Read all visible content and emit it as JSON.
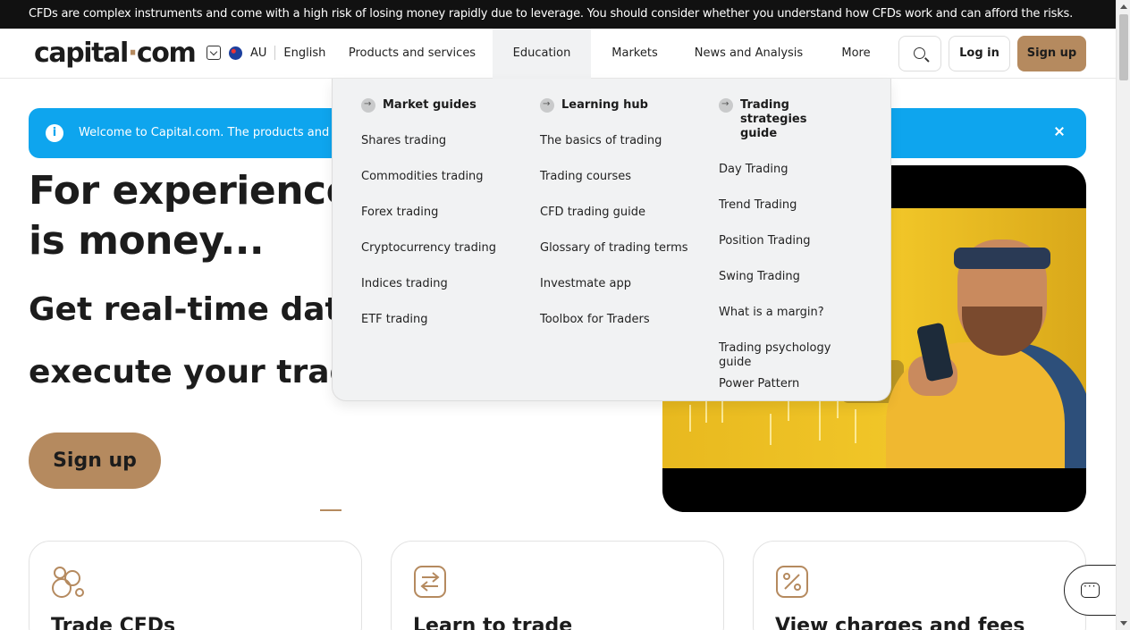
{
  "risk_warning": "CFDs are complex instruments and come with a high risk of losing money rapidly due to leverage. You should consider whether you understand how CFDs work and can afford the risks.",
  "header": {
    "logo_text_1": "capital",
    "logo_dot": "·",
    "logo_text_2": "com",
    "region_code": "AU",
    "language": "English",
    "nav": [
      "Products and services",
      "Education",
      "Markets",
      "News and Analysis",
      "More"
    ],
    "active_nav": "Education",
    "login_label": "Log in",
    "signup_label": "Sign up"
  },
  "banner": {
    "info_glyph": "i",
    "text": "Welcome to Capital.com. The products and serv"
  },
  "education_menu": {
    "columns": [
      {
        "title": "Market guides",
        "items": [
          "Shares trading",
          "Commodities trading",
          "Forex trading",
          "Cryptocurrency trading",
          "Indices trading",
          "ETF trading"
        ]
      },
      {
        "title": "Learning hub",
        "items": [
          "The basics of trading",
          "Trading courses",
          "CFD trading guide",
          "Glossary of trading terms",
          "Investmate app",
          "Toolbox for Traders"
        ]
      },
      {
        "title": "Trading strategies guide",
        "items": [
          "Day Trading",
          "Trend Trading",
          "Position Trading",
          "Swing Trading",
          "What is a margin?",
          "Trading psychology guide",
          "Power Pattern"
        ]
      }
    ]
  },
  "hero": {
    "headline_line1": "For experienced",
    "headline_line2": "is money...",
    "subline_1": "Get real-time data",
    "subline_2": "execute your trade",
    "signup_label": "Sign up"
  },
  "cards": [
    {
      "title": "Trade CFDs",
      "icon": "coins-icon"
    },
    {
      "title": "Learn to trade",
      "icon": "exchange-icon"
    },
    {
      "title": "View charges and fees",
      "icon": "percent-icon"
    }
  ],
  "colors": {
    "brand_accent": "#b58a5f",
    "banner_blue": "#0ea5ee",
    "menu_bg": "#f1f2f3",
    "risk_bar": "#111111"
  }
}
